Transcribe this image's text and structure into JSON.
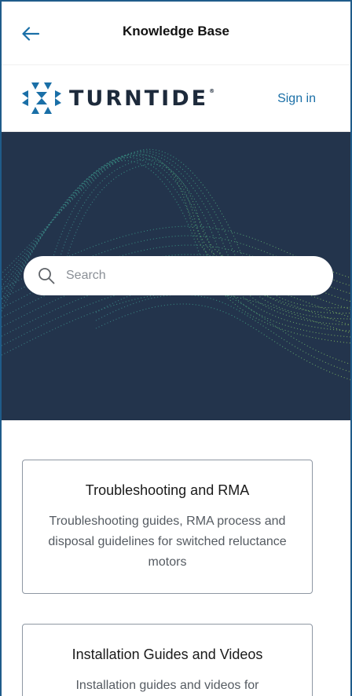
{
  "appbar": {
    "title": "Knowledge Base",
    "back_icon": "arrow-left-icon"
  },
  "header": {
    "brand_name": "TURNTIDE",
    "trademark": "®",
    "sign_in_label": "Sign in"
  },
  "hero": {
    "search_placeholder": "Search"
  },
  "cards": [
    {
      "title": "Troubleshooting and RMA",
      "description": "Troubleshooting guides, RMA process and disposal guidelines for switched reluctance motors"
    },
    {
      "title": "Installation Guides and Videos",
      "description": "Installation guides and videos for"
    }
  ],
  "colors": {
    "accent": "#1a6fa7",
    "hero_background": "#23344c",
    "brand_text": "#1d2a3b"
  }
}
